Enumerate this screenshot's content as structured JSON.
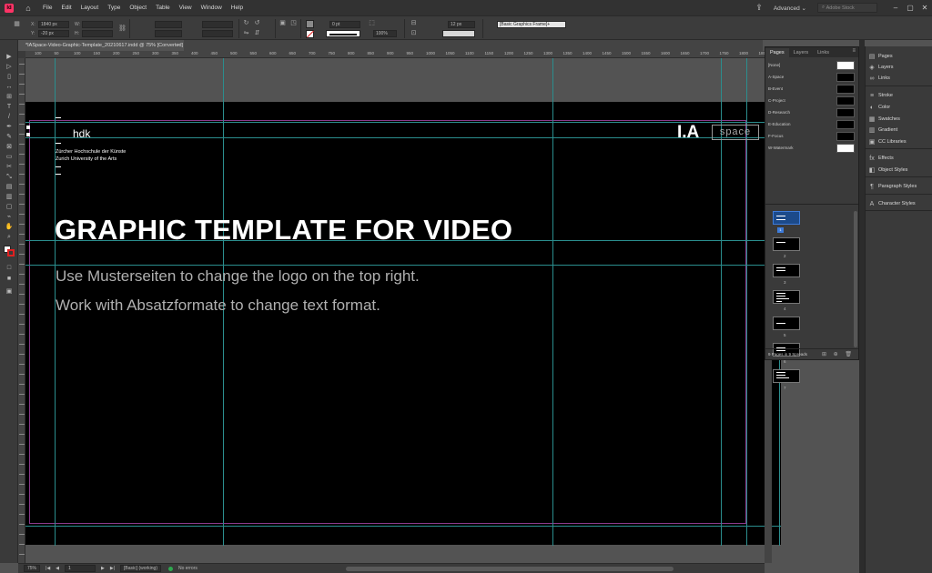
{
  "app": {
    "logo": "Id",
    "menu": [
      "File",
      "Edit",
      "Layout",
      "Type",
      "Object",
      "Table",
      "View",
      "Window",
      "Help"
    ],
    "workspace": "Advanced",
    "stock_search_placeholder": "Adobe Stock"
  },
  "control_panel": {
    "x_label": "X:",
    "x_value": "1840 px",
    "y_label": "Y:",
    "y_value": "-20 px",
    "w_label": "W:",
    "h_label": "H:",
    "stroke_weight": "0 pt",
    "opacity": "100%",
    "offset": "12 px",
    "object_style": "[Basic Graphics Frame]+"
  },
  "document": {
    "tab_title": "*IASpace-Video-Graphic-Template_20210617.indd @ 75% [Converted]",
    "tab_close": "×"
  },
  "rulers": {
    "h_ticks": [
      "100",
      "50",
      "100",
      "150",
      "200",
      "250",
      "300",
      "350",
      "400",
      "450",
      "500",
      "550",
      "600",
      "650",
      "700",
      "750",
      "800",
      "850",
      "900",
      "950",
      "1000",
      "1050",
      "1100",
      "1150",
      "1200",
      "1250",
      "1300",
      "1350",
      "1400",
      "1450",
      "1500",
      "1550",
      "1600",
      "1650",
      "1700",
      "1750",
      "1800",
      "1850"
    ]
  },
  "page_content": {
    "logo_hdk": "hdk",
    "school_de": "Zürcher Hochschule der Künste",
    "school_en": "Zurich University of the Arts",
    "heading": "GRAPHIC TEMPLATE FOR VIDEO",
    "body_line_1": "Use Musterseiten to change the logo on the top right.",
    "body_line_2": "Work with Absatzformate to change text format.",
    "logo_ia": "I.A",
    "logo_space": "space"
  },
  "pages_panel": {
    "tabs": [
      "Pages",
      "Layers",
      "Links"
    ],
    "active_tab": "Pages",
    "menu_icon": "≡",
    "masters": [
      "[None]",
      "A-Space",
      "B-Event",
      "C-Project",
      "D-Research",
      "E-Education",
      "F-Focus",
      "W-Watermark"
    ],
    "master_white": [
      true,
      false,
      false,
      false,
      false,
      false,
      false,
      true
    ],
    "spreads": [
      "1",
      "2",
      "3",
      "4",
      "5",
      "6",
      "7"
    ],
    "selected_spread": "1",
    "footer": "9 Pages in 9 Spreads",
    "footer_icons": "⊞ ⊕ 🗑"
  },
  "dock": {
    "items": [
      {
        "label": "Pages",
        "icon": "pages-icon",
        "glyph": "▤"
      },
      {
        "label": "Layers",
        "icon": "layers-icon",
        "glyph": "◈"
      },
      {
        "label": "Links",
        "icon": "links-icon",
        "glyph": "∞"
      },
      {
        "label": "Stroke",
        "icon": "stroke-icon",
        "glyph": "≡"
      },
      {
        "label": "Color",
        "icon": "color-icon",
        "glyph": "◐"
      },
      {
        "label": "Swatches",
        "icon": "swatches-icon",
        "glyph": "▦"
      },
      {
        "label": "Gradient",
        "icon": "gradient-icon",
        "glyph": "▥"
      },
      {
        "label": "CC Libraries",
        "icon": "cc-libraries-icon",
        "glyph": "▣"
      },
      {
        "label": "Effects",
        "icon": "effects-icon",
        "glyph": "fx"
      },
      {
        "label": "Object Styles",
        "icon": "object-styles-icon",
        "glyph": "◧"
      },
      {
        "label": "Paragraph Styles",
        "icon": "paragraph-styles-icon",
        "glyph": "¶"
      },
      {
        "label": "Character Styles",
        "icon": "character-styles-icon",
        "glyph": "A"
      }
    ]
  },
  "status_bar": {
    "zoom": "75%",
    "page_number": "1",
    "style": "[Basic] (working)",
    "preflight": "No errors"
  },
  "colors": {
    "guide": "#2b8e8e",
    "margin": "#8b3a8b",
    "selection": "#3d7bd9",
    "preflight_ok": "#2fa84f"
  }
}
